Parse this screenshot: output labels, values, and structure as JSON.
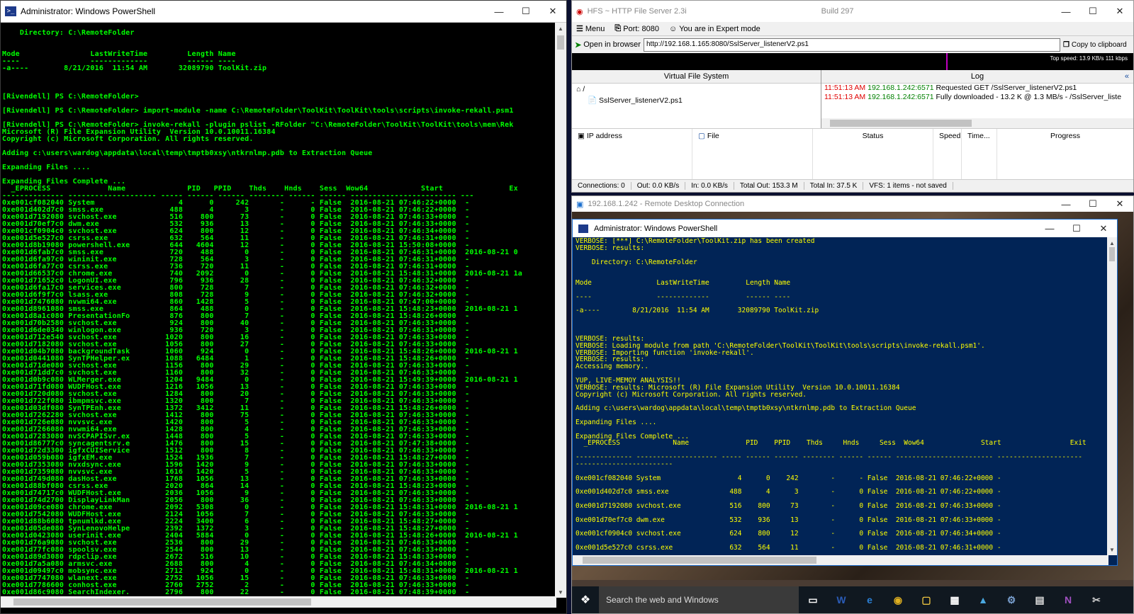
{
  "left_ps": {
    "title": "Administrator: Windows PowerShell",
    "lines": [
      "",
      "    Directory: C:\\RemoteFolder",
      "",
      "",
      "Mode                LastWriteTime         Length Name",
      "----                -------------         ------ ----",
      "-a----        8/21/2016  11:54 AM       32089790 ToolKit.zip",
      "",
      "",
      "",
      "[Rivendell] PS C:\\RemoteFolder>",
      "",
      "[Rivendell] PS C:\\RemoteFolder> import-module -name C:\\RemoteFolder\\ToolKit\\ToolKit\\tools\\scripts\\invoke-rekall.psm1",
      "",
      "[Rivendell] PS C:\\RemoteFolder> invoke-rekall -plugin pslist -RFolder \"C:\\RemoteFolder\\ToolKit\\ToolKit\\tools\\mem\\Rek",
      "Microsoft (R) File Expansion Utility  Version 10.0.10011.16384",
      "Copyright (c) Microsoft Corporation. All rights reserved.",
      "",
      "Adding c:\\users\\wardog\\appdata\\local\\temp\\tmptb0xsy\\ntkrnlmp.pdb to Extraction Queue",
      "",
      "Expanding Files ....",
      "",
      "Expanding Files Complete ...",
      "  _EPROCESS             Name              PID   PPID    Thds    Hnds    Sess  Wow64            Start               Ex",
      "-------------- -------------------- ----- ------ ------ -------- ------ ------ ------------------------ ---",
      "0xe001cf082040 System                   4      0     242       -      - False  2016-08-21 07:46:22+0000  -",
      "0xe001d402d7c0 smss.exe               488      4       3       -      0 False  2016-08-21 07:46:22+0000  -",
      "0xe001d7192080 svchost.exe            516    800      73       -      0 False  2016-08-21 07:46:33+0000  -",
      "0xe001d70ef7c0 dwm.exe                532    936      13       -      0 False  2016-08-21 07:46:33+0000  -",
      "0xe001cf0904c0 svchost.exe            624    800      12       -      0 False  2016-08-21 07:46:34+0000  -",
      "0xe001d5e527c0 csrss.exe              632    564      11       -      0 False  2016-08-21 07:46:31+0000  -",
      "0xe001d8b19080 powershell.exe         644   4604      12       -      0 False  2016-08-21 15:50:08+0000  -",
      "0xe001d6fab7c0 smss.exe               720    488       0       -      0 False  2016-08-21 07:46:31+0000  2016-08-21 0",
      "0xe001d6fa97c0 wininit.exe            728    564       3       -      0 False  2016-08-21 07:46:31+0000  -",
      "0xe001d6fa77c0 csrss.exe              736    720      11       -      0 False  2016-08-21 07:46:31+0000  -",
      "0xe001d66537c0 chrome.exe             740   2092       0       -      0 False  2016-08-21 15:48:31+0000  2016-08-21 1a",
      "0xe001d71652c0 LogonUI.exe            796    936      28       -      0 False  2016-08-21 07:46:32+0000  -",
      "0xe001d6fa17c0 services.exe           800    728       7       -      0 False  2016-08-21 07:46:32+0000  -",
      "0xe001d6f9f7c0 lsass.exe              808    728       9       -      0 False  2016-08-21 07:46:32+0000  -",
      "0xe001d7476080 nvwmi64.exe            860   1428       5       -      0 False  2016-08-21 07:47:00+0000  -",
      "0xe001d8961080 smss.exe               864    488       0       -      0 False  2016-08-21 15:48:23+0000  2016-08-21 1",
      "0xe001d8a1c080 PresentationFo         876    800       7       -      0 False  2016-08-21 15:48:26+0000  -",
      "0xe001d70b2580 svchost.exe            924    800      40       -      0 False  2016-08-21 07:46:33+0000  -",
      "0xe001d6de0340 winlogon.exe           936    720       3       -      0 False  2016-08-21 07:46:31+0000  -",
      "0xe001d712e540 svchost.exe           1020    800      16       -      0 False  2016-08-21 07:46:33+0000  -",
      "0xe001d7182080 svchost.exe           1056    800      27       -      0 False  2016-08-21 07:46:33+0000  -",
      "0xe001d04b7080 backgroundTask        1060    924       0       -      0 False  2016-08-21 15:48:26+0000  2016-08-21 1",
      "0xe001d0441080 SynTPHelper.ex        1088   6484       1       -      0 False  2016-08-21 15:48:26+0000  -",
      "0xe001d71de080 svchost.exe           1156    800      29       -      0 False  2016-08-21 07:46:33+0000  -",
      "0xe001d71dd7c0 svchost.exe           1160    800      32       -      0 False  2016-08-21 07:46:33+0000  -",
      "0xe001d0b9c080 WLMerger.exe          1204   9484       0       -      0 False  2016-08-21 15:49:39+0000  2016-08-21 1",
      "0xe001d71fd080 WUDFHost.exe          1216   1056      13       -      0 False  2016-08-21 07:46:33+0000  -",
      "0xe001d720d080 svchost.exe           1284    800      20       -      0 False  2016-08-21 07:46:33+0000  -",
      "0xe001d722f080 ibmpmsvc.exe          1320    800       7       -      0 False  2016-08-21 07:46:33+0000  -",
      "0xe001d03df080 SynTPEnh.exe          1372   3412      11       -      0 False  2016-08-21 15:48:26+0000  -",
      "0xe001d7262280 svchost.exe           1412    800      75       -      0 False  2016-08-21 07:46:33+0000  -",
      "0xe001d726e080 nvvsvc.exe            1420    800       5       -      0 False  2016-08-21 07:46:33+0000  -",
      "0xe001d7266080 nvwmi64.exe           1428    800       4       -      0 False  2016-08-21 07:46:33+0000  -",
      "0xe001d7283080 nvSCPAPISvr.ex        1448    800       5       -      0 False  2016-08-21 07:46:33+0000  -",
      "0xe001d86777c0 syncagentsrv.e        1476    800      15       -      0 False  2016-08-21 07:47:38+0000  -",
      "0xe001d72d3300 igfxCUIService        1512    800       8       -      0 False  2016-08-21 07:46:33+0000  -",
      "0xe001d059b080 igfxEM.exe            1524   1936       7       -      0 False  2016-08-21 15:48:27+0000  -",
      "0xe001d7353080 nvxdsync.exe          1596   1420       9       -      0 False  2016-08-21 07:46:33+0000  -",
      "0xe001d7359080 nvvsvc.exe            1616   1420       5       -      0 False  2016-08-21 07:46:33+0000  -",
      "0xe001d749d080 dasHost.exe           1768   1056      13       -      0 False  2016-08-21 07:46:33+0000  -",
      "0xe001d88bf080 csrss.exe             2020    864      14       -      0 False  2016-08-21 15:48:23+0000  -",
      "0xe001d74717c0 WUDFHost.exe          2036   1056       9       -      0 False  2016-08-21 07:46:33+0000  -",
      "0xe001d74d2700 DisplayLinkMan        2056    800      36       -      0 False  2016-08-21 07:46:33+0000  -",
      "0xe001d09ce080 chrome.exe            2092   5308       0       -      0 False  2016-08-21 15:48:31+0000  2016-08-21 1",
      "0xe001d7542080 WUDFHost.exe          2124   1056       7       -      0 False  2016-08-21 07:46:33+0000  -",
      "0xe001d88b6080 tpnumlkd.exe          2224   3400       6       -      0 False  2016-08-21 15:48:27+0000  -",
      "0xe001d05de080 SynLenovoHelpe        2392   1372       3       -      0 False  2016-08-21 15:48:27+0000  -",
      "0xe001d0423080 userinit.exe          2404   5884       0       -      0 False  2016-08-21 15:48:26+0000  2016-08-21 1",
      "0xe001d76a9080 svchost.exe           2536    800      29       -      0 False  2016-08-21 07:46:33+0000  -",
      "0xe001d77fc080 spoolsv.exe           2544    800      13       -      0 False  2016-08-21 07:46:33+0000  -",
      "0xe001d89d3080 rdpclip.exe           2672    516      10       -      0 False  2016-08-21 15:48:33+0000  -",
      "0xe001d7a5a080 armsvc.exe            2688    800       4       -      0 False  2016-08-21 07:46:34+0000  -",
      "0xe001d09497c0 mobsync.exe           2712    924       0       -      0 False  2016-08-21 15:48:31+0000  2016-08-21 1",
      "0xe001d7747080 wlanext.exe           2752   1056      15       -      0 False  2016-08-21 07:46:33+0000  -",
      "0xe001d7786600 conhost.exe           2760   2752       2       -      0 False  2016-08-21 07:46:33+0000  -",
      "0xe001d86c9080 SearchIndexer.        2796    800      22       -      0 False  2016-08-21 07:48:39+0000  -"
    ]
  },
  "hfs": {
    "title": "HFS ~ HTTP File Server 2.3i",
    "build": "Build 297",
    "menu": "Menu",
    "port": "Port: 8080",
    "mode": "You are in Expert mode",
    "open_browser": "Open in browser",
    "url": "http://192.168.1.165:8080/SslServer_listenerV2.ps1",
    "copy": "Copy to clipboard",
    "top_speed": "Top speed: 13.9 KB/s     111 kbps",
    "vfs_title": "Virtual File System",
    "vfs_root": "/",
    "vfs_file": "SslServer_listenerV2.ps1",
    "log_title": "Log",
    "log": [
      {
        "time": "11:51:13 AM",
        "ip": "192.168.1.242:6571",
        "msg": "Requested GET /SslServer_listenerV2.ps1"
      },
      {
        "time": "11:51:13 AM",
        "ip": "192.168.1.242:6571",
        "msg": "Fully downloaded - 13.2 K @ 1.3 MB/s - /SslServer_liste"
      }
    ],
    "cols": {
      "ip": "IP address",
      "file": "File",
      "status": "Status",
      "speed": "Speed",
      "time": "Time...",
      "progress": "Progress"
    },
    "status": [
      "Connections: 0",
      "Out: 0.0 KB/s",
      "In: 0.0 KB/s",
      "Total Out: 153.3 M",
      "Total In: 37.5 K",
      "VFS: 1 items - not saved"
    ]
  },
  "rdp": {
    "title": "192.168.1.242 - Remote Desktop Connection",
    "ps_title": "Administrator: Windows PowerShell",
    "lines": [
      "VERBOSE: [***] C:\\RemoteFolder\\ToolKit.zip has been created",
      "VERBOSE: results:",
      "",
      "    Directory: C:\\RemoteFolder",
      "",
      "",
      "Mode                LastWriteTime         Length Name",
      "",
      "----                -------------         ------ ----",
      "",
      "-a----        8/21/2016  11:54 AM       32089790 ToolKit.zip",
      "",
      "",
      "",
      "VERBOSE: results:",
      "VERBOSE: Loading module from path 'C:\\RemoteFolder\\ToolKit\\ToolKit\\tools\\scripts\\invoke-rekall.psm1'.",
      "VERBOSE: Importing function 'invoke-rekall'.",
      "VERBOSE: results:",
      "Accessing memory..",
      "",
      "YUP, LIVE-MEMOY ANALYSIS!!",
      "VERBOSE: results: Microsoft (R) File Expansion Utility  Version 10.0.10011.16384",
      "Copyright (c) Microsoft Corporation. All rights reserved.",
      "",
      "Adding c:\\users\\wardog\\appdata\\local\\temp\\tmptb0xsy\\ntkrnlmp.pdb to Extraction Queue",
      "",
      "Expanding Files ....",
      "",
      "Expanding Files Complete ...",
      "  _EPROCESS             Name              PID    PPID    Thds     Hnds     Sess  Wow64              Start                 Exit",
      "",
      "-------------- -------------------- ----- ------ ------ -------- ------ ------ ------------------------ ---------------------",
      "------------------------",
      "",
      "0xe001cf082040 System                   4      0    242        -      - False  2016-08-21 07:46:22+0000 -",
      "",
      "0xe001d402d7c0 smss.exe               488      4      3        -      0 False  2016-08-21 07:46:22+0000 -",
      "",
      "0xe001d7192080 svchost.exe            516    800     73        -      0 False  2016-08-21 07:46:33+0000 -",
      "",
      "0xe001d70ef7c0 dwm.exe                532    936     13        -      0 False  2016-08-21 07:46:33+0000 -",
      "",
      "0xe001cf0904c0 svchost.exe            624    800     12        -      0 False  2016-08-21 07:46:34+0000 -",
      "",
      "0xe001d5e527c0 csrss.exe              632    564     11        -      0 False  2016-08-21 07:46:31+0000 -"
    ],
    "search": "Search the web and Windows"
  }
}
